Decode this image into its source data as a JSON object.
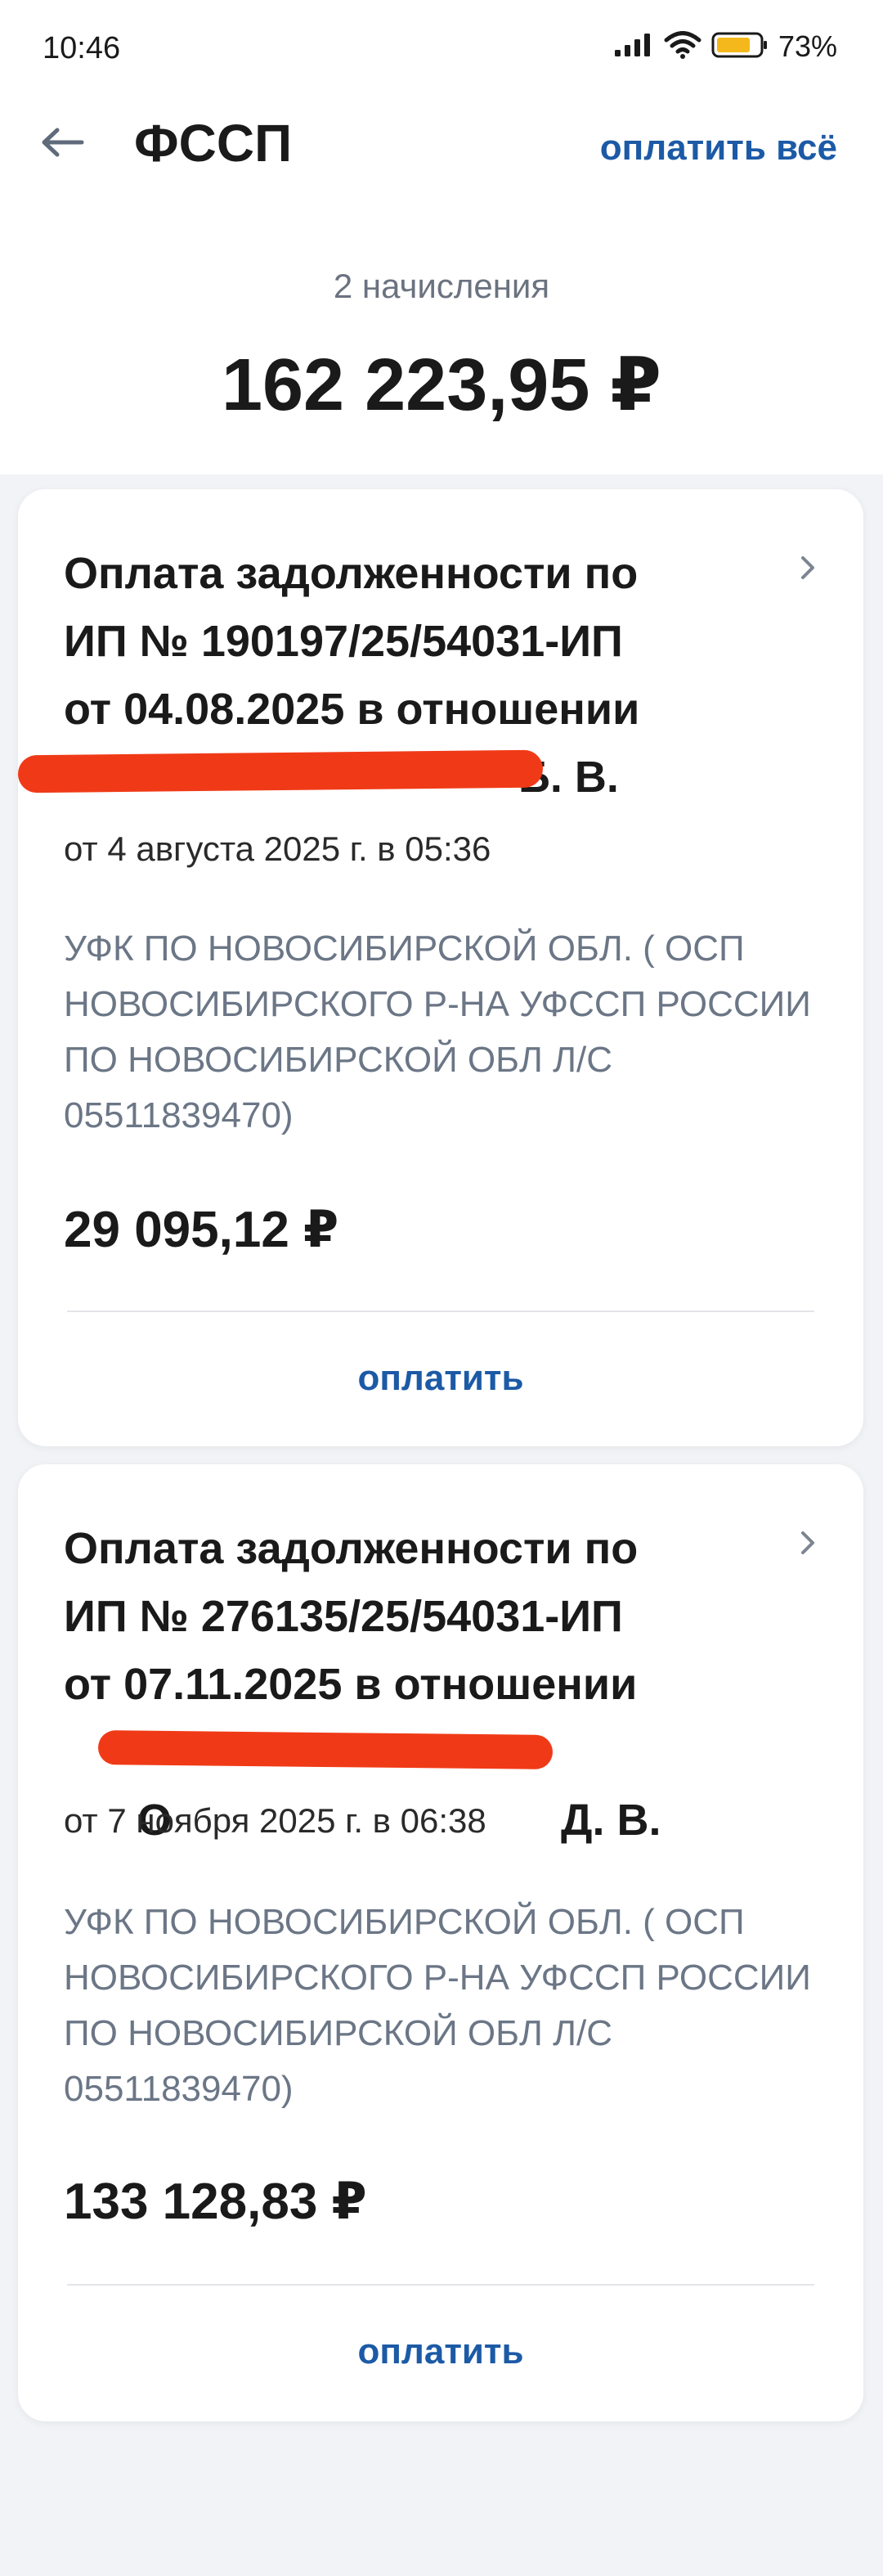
{
  "status_bar": {
    "time": "10:46",
    "battery": "73%"
  },
  "header": {
    "title": "ФССП",
    "pay_all": "оплатить всё"
  },
  "summary": {
    "count": "2 начисления",
    "total": "162 223,95 ₽"
  },
  "charges": [
    {
      "title_line1": "Оплата задолженности по",
      "title_line2": "ИП № 190197/25/54031-ИП",
      "title_line3": "от 04.08.2025 в отношении",
      "title_line4": "Б. В.",
      "date": "от 4 августа 2025 г. в 05:36",
      "recipient": "УФК ПО НОВОСИБИРСКОЙ ОБЛ. ( ОСП НОВОСИБИРСКОГО Р-НА УФССП РОССИИ ПО НОВОСИБИРСКОЙ ОБЛ Л/С 05511839470)",
      "amount": "29 095,12 ₽",
      "pay_label": "оплатить"
    },
    {
      "title_line1": "Оплата задолженности по",
      "title_line2": "ИП № 276135/25/54031-ИП",
      "title_line3": "от 07.11.2025 в отношении",
      "title_line4": "О Д. В.",
      "date": "от 7 ноября 2025 г. в 06:38",
      "recipient": "УФК ПО НОВОСИБИРСКОЙ ОБЛ. ( ОСП НОВОСИБИРСКОГО Р-НА УФССП РОССИИ ПО НОВОСИБИРСКОЙ ОБЛ Л/С 05511839470)",
      "amount": "133 128,83 ₽",
      "pay_label": "оплатить"
    }
  ],
  "icons": {
    "back": "arrow-left-icon",
    "chevron": "chevron-right-icon",
    "signal": "signal-icon",
    "wifi": "wifi-icon",
    "battery": "battery-icon"
  },
  "colors": {
    "accent": "#1c5aa6",
    "redaction": "#f03a17",
    "background": "#f1f3f6"
  }
}
